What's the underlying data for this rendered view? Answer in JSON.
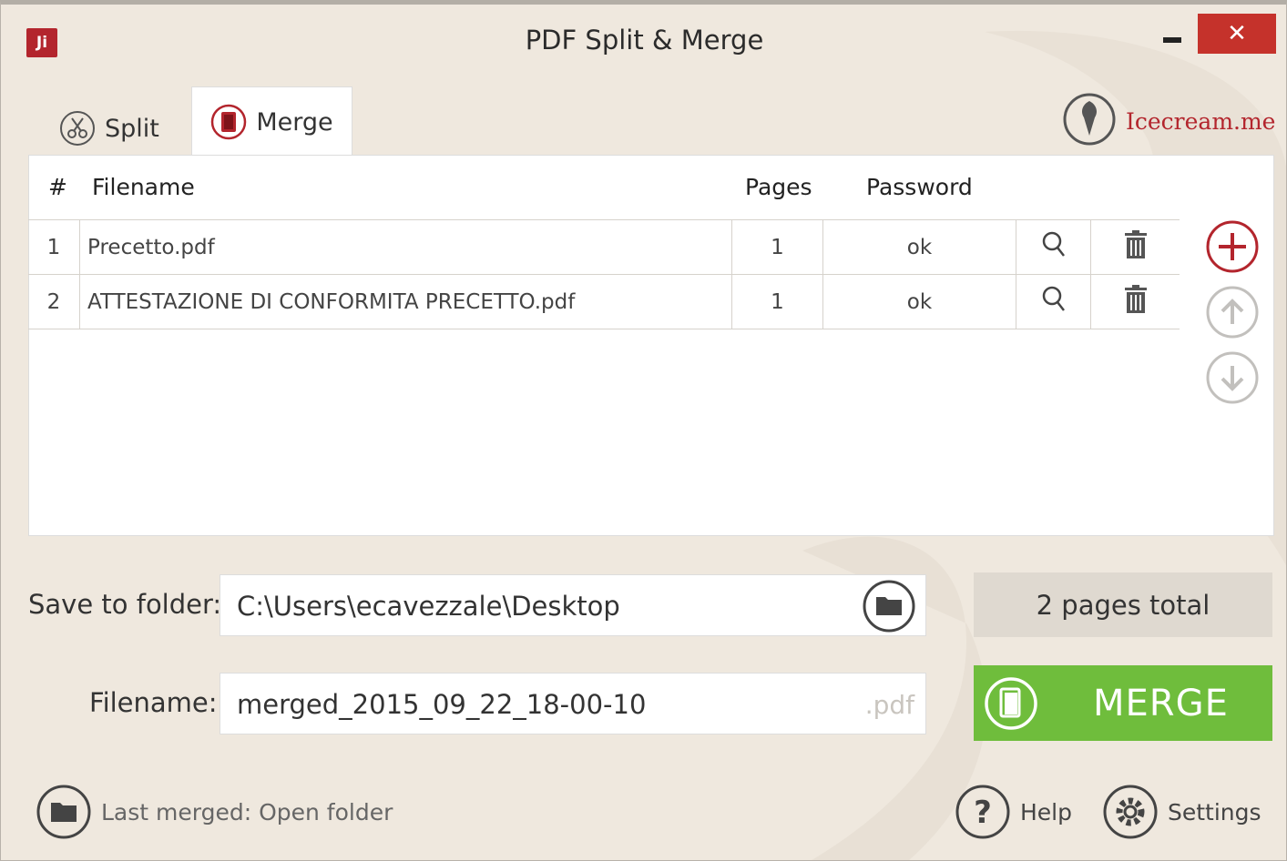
{
  "window": {
    "title": "PDF Split & Merge",
    "app_icon_text": "Ji",
    "close_glyph": "✕"
  },
  "tabs": [
    {
      "label": "Split"
    },
    {
      "label": "Merge"
    }
  ],
  "brand": {
    "link": "Icecream.me"
  },
  "table": {
    "headers": {
      "num": "#",
      "filename": "Filename",
      "pages": "Pages",
      "password": "Password"
    },
    "rows": [
      {
        "num": "1",
        "filename": "Precetto.pdf",
        "pages": "1",
        "password": "ok"
      },
      {
        "num": "2",
        "filename": "ATTESTAZIONE DI CONFORMITA PRECETTO.pdf",
        "pages": "1",
        "password": "ok"
      }
    ]
  },
  "save": {
    "label": "Save to folder:",
    "path": "C:\\Users\\ecavezzale\\Desktop"
  },
  "output": {
    "label": "Filename:",
    "value": "merged_2015_09_22_18-00-10",
    "extension": ".pdf"
  },
  "summary": {
    "total": "2 pages total"
  },
  "merge": {
    "label": "MERGE"
  },
  "footer": {
    "last_merged": "Last merged: Open folder",
    "help": "Help",
    "settings": "Settings"
  },
  "colors": {
    "accent": "#b3252d",
    "merge_green": "#6fbd3c",
    "background": "#efe8de"
  },
  "icons": [
    "app-icon",
    "minimize-icon",
    "close-icon",
    "scissors-icon",
    "book-icon",
    "icecream-icon",
    "magnifier-icon",
    "trash-icon",
    "plus-icon",
    "arrow-up-icon",
    "arrow-down-icon",
    "folder-icon",
    "help-icon",
    "gear-icon"
  ]
}
